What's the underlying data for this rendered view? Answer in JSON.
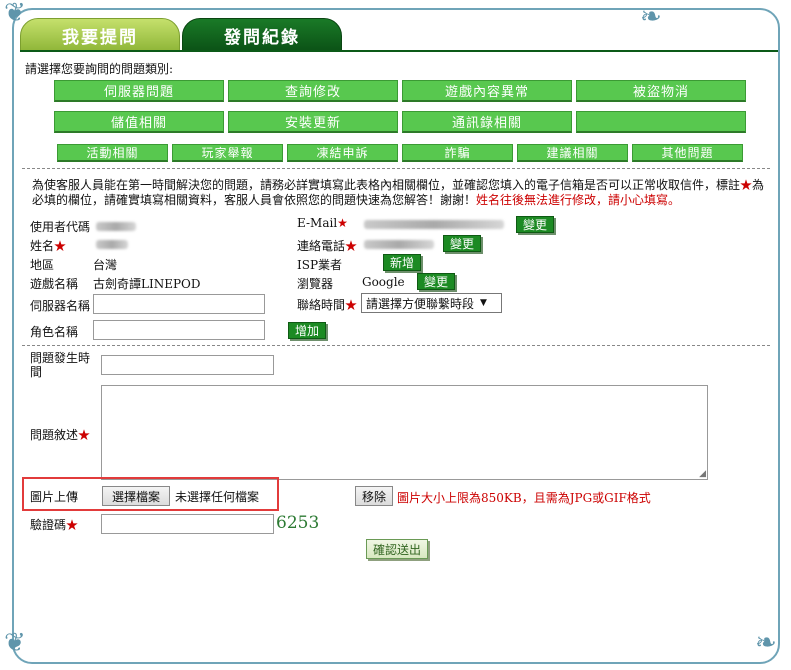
{
  "tabs": {
    "ask": "我要提問",
    "records": "發問紀錄"
  },
  "prompt": "請選擇您要詢問的問題類別:",
  "categories_row1": [
    "伺服器問題",
    "查詢修改",
    "遊戲內容異常",
    "被盜物消"
  ],
  "categories_row2": [
    "儲值相關",
    "安裝更新",
    "通訊錄相關",
    ""
  ],
  "categories_row3": [
    "活動相關",
    "玩家舉報",
    "凍結申訴",
    "詐騙",
    "建議相關",
    "其他問題"
  ],
  "notice": {
    "line1": "為使客服人員能在第一時間解決您的問題，請務必詳實填寫此表格內相關欄位，並確認您填入的電子信箱是否可以正常收取信件，標註",
    "star": "★",
    "line1_end": "為",
    "line2": "必填的欄位，請確實填寫相關資料，客服人員會依照您的問題快速為您解答！謝謝！",
    "warn": "姓名往後無法進行修改，請小心填寫。"
  },
  "labels": {
    "user_id": "使用者代碼",
    "name": "姓名",
    "region": "地區",
    "game": "遊戲名稱",
    "server": "伺服器名稱",
    "character": "角色名稱",
    "email": "E-Mail",
    "phone": "連絡電話",
    "isp": "ISP業者",
    "browser": "瀏覽器",
    "contact_time": "聯絡時間",
    "issue_time": "問題發生時間",
    "issue_desc": "問題敘述",
    "image_upload": "圖片上傳",
    "captcha": "驗證碼"
  },
  "values": {
    "region": "台灣",
    "game": "古劍奇譚LINEPOD",
    "browser": "Google",
    "contact_time": "請選擇方便聯繫時段",
    "captcha_code": "6253",
    "no_file": "未選擇任何檔案"
  },
  "buttons": {
    "change_email": "變更",
    "change_phone": "變更",
    "add_isp": "新增",
    "change_browser": "變更",
    "add_character": "增加",
    "choose_file": "選擇檔案",
    "remove": "移除",
    "submit": "確認送出"
  },
  "upload_note": "圖片大小上限為850KB，且需為JPG或GIF格式"
}
